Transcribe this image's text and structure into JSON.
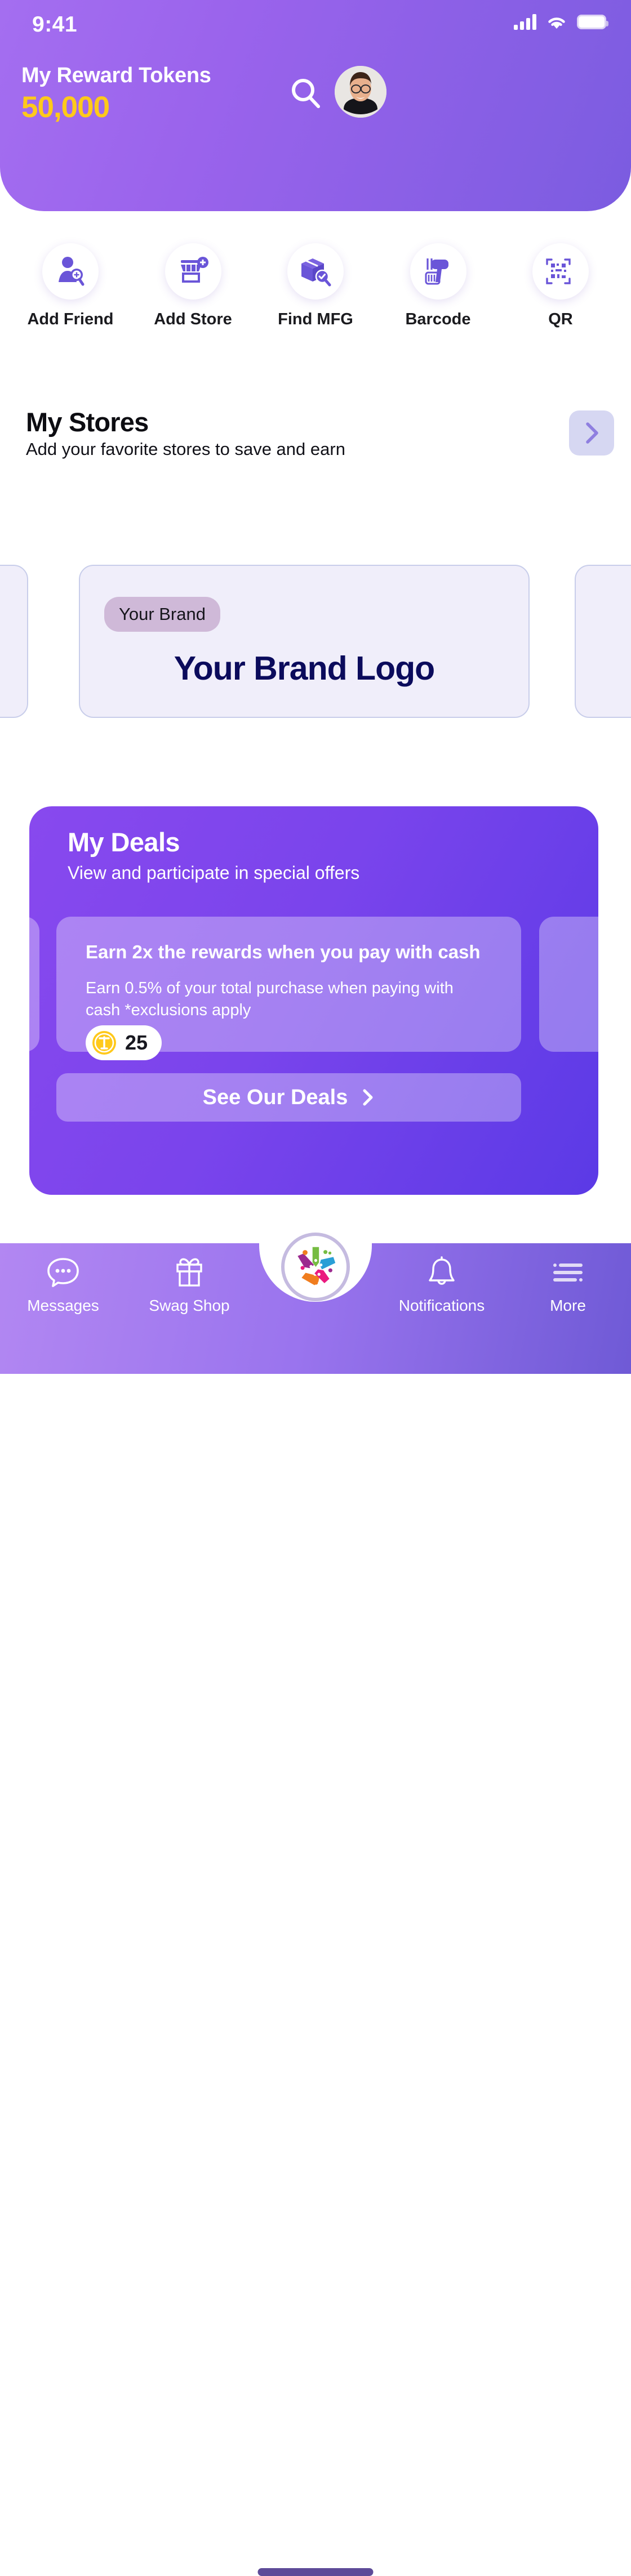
{
  "status_bar": {
    "time": "9:41",
    "signal_icon": "cellular-signal-icon",
    "wifi_icon": "wifi-icon",
    "battery_icon": "battery-icon"
  },
  "header": {
    "title": "My Reward Tokens",
    "amount": "50,000",
    "search_icon": "search-icon",
    "avatar": "user-avatar",
    "gradient_from": "#a46ef0",
    "gradient_to": "#7b5ce0",
    "amount_color": "#ffc91b"
  },
  "quick_actions": [
    {
      "label": "Add Friend",
      "icon": "add-friend-icon"
    },
    {
      "label": "Add Store",
      "icon": "add-store-icon"
    },
    {
      "label": "Find MFG",
      "icon": "find-mfg-icon"
    },
    {
      "label": "Barcode",
      "icon": "barcode-scanner-icon"
    },
    {
      "label": "QR",
      "icon": "qr-code-icon"
    }
  ],
  "my_stores": {
    "title": "My Stores",
    "subtitle": "Add your favorite stores to save and earn",
    "next_icon": "chevron-right-icon",
    "cards": [
      {
        "badge": "Your Brand",
        "logo_text": "Your Brand Logo"
      }
    ]
  },
  "my_deals": {
    "title": "My Deals",
    "subtitle": "View and participate in special offers",
    "deal": {
      "headline": "Earn 2x the rewards when you pay with cash",
      "description": "Earn 0.5% of your total purchase when paying with cash *exclusions apply",
      "token_icon": "token-coin-icon",
      "token_value": "25"
    },
    "cta_label": "See Our Deals",
    "cta_icon": "chevron-right-icon",
    "accent": "#7a44ec"
  },
  "bottom_nav": {
    "items": [
      {
        "label": "Messages",
        "icon": "chat-bubble-icon"
      },
      {
        "label": "Swag Shop",
        "icon": "gift-icon"
      },
      {
        "label": "Notifications",
        "icon": "bell-icon"
      },
      {
        "label": "More",
        "icon": "menu-list-icon"
      }
    ],
    "center_button": {
      "icon": "price-tags-logo-icon"
    },
    "home_indicator": "home-indicator"
  }
}
